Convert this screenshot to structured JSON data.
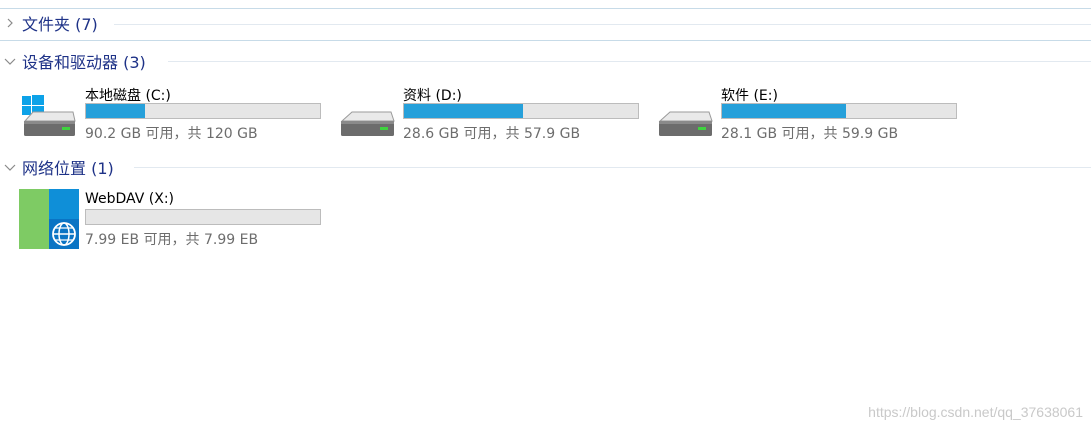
{
  "groups": {
    "folders": {
      "title": "文件夹 (7)",
      "expanded": false
    },
    "devices": {
      "title": "设备和驱动器 (3)",
      "expanded": true
    },
    "network": {
      "title": "网络位置 (1)",
      "expanded": true
    }
  },
  "drives": [
    {
      "label": "本地磁盘 (C:)",
      "space": "90.2 GB 可用，共 120 GB",
      "used_fraction": 0.25,
      "icon": "windows-drive-icon"
    },
    {
      "label": "资料 (D:)",
      "space": "28.6 GB 可用，共 57.9 GB",
      "used_fraction": 0.51,
      "icon": "hard-drive-icon"
    },
    {
      "label": "软件 (E:)",
      "space": "28.1 GB 可用，共 59.9 GB",
      "used_fraction": 0.53,
      "icon": "hard-drive-icon"
    }
  ],
  "network_drives": [
    {
      "label": "WebDAV (X:)",
      "space": "7.99 EB 可用，共 7.99 EB",
      "used_fraction": 0.0,
      "icon": "network-drive-icon"
    }
  ],
  "watermark": "https://blog.csdn.net/qq_37638061",
  "colors": {
    "group_title": "#1e3287",
    "bar_fill": "#26a0da",
    "bar_track": "#e6e6e6",
    "secondary_text": "#6d6d6d"
  }
}
